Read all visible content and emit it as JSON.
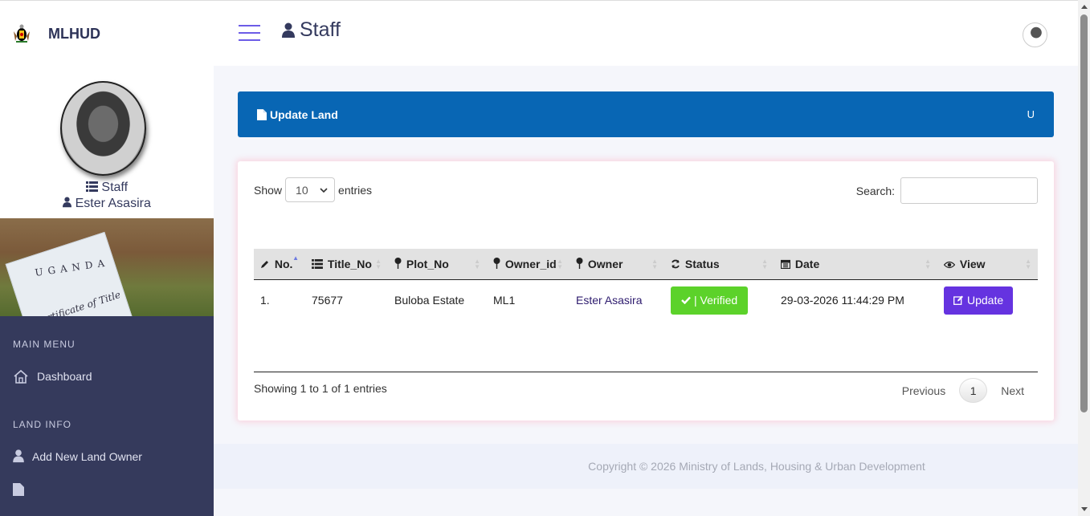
{
  "brand": {
    "name": "MLHUD"
  },
  "header": {
    "title": "Staff"
  },
  "profile": {
    "role": "Staff",
    "name": "Ester Asasira"
  },
  "banner_image": {
    "line1": "UGANDA",
    "line2": "Certificate of Title"
  },
  "nav": {
    "section_main": "MAIN MENU",
    "dashboard": "Dashboard",
    "section_land": "LAND INFO",
    "add_owner": "Add New Land Owner"
  },
  "page_banner": {
    "title": "Update Land",
    "right": "U"
  },
  "table_controls": {
    "show_label": "Show",
    "entries_value": "10",
    "entries_label": "entries",
    "search_label": "Search:"
  },
  "table": {
    "headers": {
      "no": "No.",
      "title_no": "Title_No",
      "plot_no": "Plot_No",
      "owner_id": "Owner_id",
      "owner": "Owner",
      "status": "Status",
      "date": "Date",
      "view": "View"
    },
    "rows": [
      {
        "no": "1.",
        "title_no": "75677",
        "plot_no": "Buloba Estate",
        "owner_id": "ML1",
        "owner": "Ester Asasira",
        "status": "| Verified",
        "date": "29-03-2026 11:44:29 PM",
        "action": "Update"
      }
    ]
  },
  "pagination": {
    "info": "Showing 1 to 1 of 1 entries",
    "previous": "Previous",
    "current": "1",
    "next": "Next"
  },
  "footer": {
    "copyright": "Copyright © 2026 Ministry of Lands, Housing & Urban Development"
  },
  "colors": {
    "banner": "#0866b4",
    "sidebar_nav": "#353a5c",
    "verified": "#5cd22a",
    "update_button": "#6533e0",
    "accent": "#6c5ce7"
  }
}
